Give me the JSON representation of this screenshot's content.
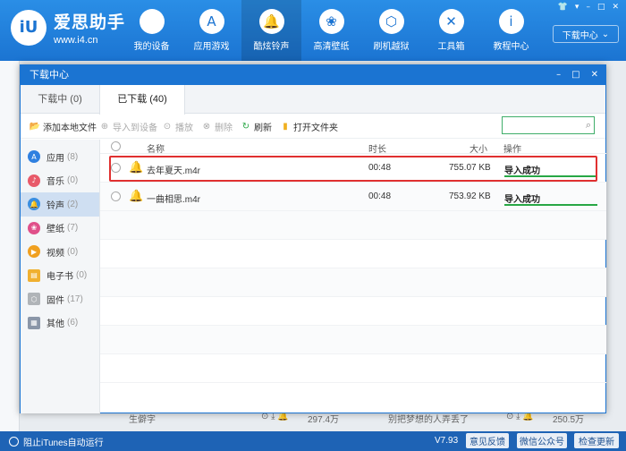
{
  "app": {
    "logo_mark": "iU",
    "name": "爱思助手",
    "url": "www.i4.cn",
    "window_buttons": [
      "👕",
      "▾",
      "–",
      "□",
      "✕"
    ],
    "download_center_label": "下载中心",
    "nav": [
      {
        "label": "我的设备",
        "icon": "apple-icon",
        "glyph": ""
      },
      {
        "label": "应用游戏",
        "icon": "app-store-icon",
        "glyph": "A"
      },
      {
        "label": "酷炫铃声",
        "icon": "bell-icon",
        "glyph": "🔔"
      },
      {
        "label": "高清壁纸",
        "icon": "flower-icon",
        "glyph": "❀"
      },
      {
        "label": "刷机越狱",
        "icon": "box-icon",
        "glyph": "⬡"
      },
      {
        "label": "工具箱",
        "icon": "tools-icon",
        "glyph": "✕"
      },
      {
        "label": "教程中心",
        "icon": "info-icon",
        "glyph": "i"
      }
    ]
  },
  "background": {
    "row_title": "生僻字",
    "row_count_left": "297.4万",
    "row_desc": "别把梦想的人弄丢了",
    "row_count_right": "250.5万"
  },
  "footer": {
    "itunes_label": "阻止iTunes自动运行",
    "version": "V7.93",
    "feedback": "意见反馈",
    "wechat": "微信公众号",
    "update": "检查更新"
  },
  "dialog": {
    "title": "下载中心",
    "controls": [
      "–",
      "□",
      "✕"
    ],
    "tabs": [
      {
        "label": "下载中 (0)"
      },
      {
        "label": "已下载 (40)"
      }
    ],
    "toolbar": {
      "add_local": "添加本地文件",
      "import_device": "导入到设备",
      "play": "播放",
      "delete": "删除",
      "refresh": "刷新",
      "open_folder": "打开文件夹"
    },
    "categories": [
      {
        "label": "应用",
        "count": "(8)",
        "color": "#2f80e0",
        "glyph": "A"
      },
      {
        "label": "音乐",
        "count": "(0)",
        "color": "#e85a6a",
        "glyph": "♪"
      },
      {
        "label": "铃声",
        "count": "(2)",
        "color": "#3a8ee0",
        "glyph": "🔔"
      },
      {
        "label": "壁纸",
        "count": "(7)",
        "color": "#e0508a",
        "glyph": "❀"
      },
      {
        "label": "视频",
        "count": "(0)",
        "color": "#f0a020",
        "glyph": "▶"
      },
      {
        "label": "电子书",
        "count": "(0)",
        "color": "#f0b030",
        "glyph": "▤"
      },
      {
        "label": "固件",
        "count": "(17)",
        "color": "#b0b4b8",
        "glyph": "⬡"
      },
      {
        "label": "其他",
        "count": "(6)",
        "color": "#8a96a8",
        "glyph": "▦"
      }
    ],
    "columns": {
      "name": "名称",
      "duration": "时长",
      "size": "大小",
      "action": "操作"
    },
    "rows": [
      {
        "name": "去年夏天.m4r",
        "duration": "00:48",
        "size": "755.07 KB",
        "status": "导入成功"
      },
      {
        "name": "一曲相思.m4r",
        "duration": "00:48",
        "size": "753.92 KB",
        "status": "导入成功"
      }
    ],
    "status_color": "#28a745",
    "highlight_color": "#e03030"
  }
}
